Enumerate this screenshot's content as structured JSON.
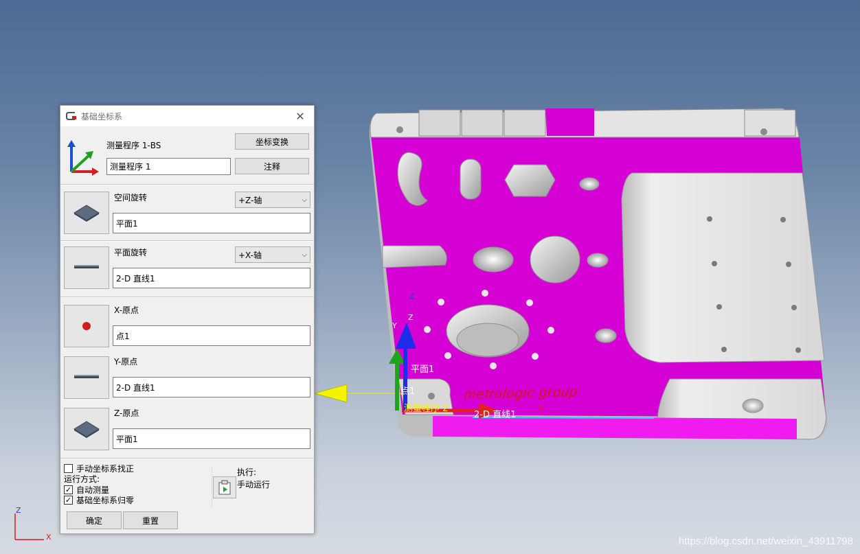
{
  "dialog": {
    "title": "基础坐标系",
    "program_label": "测量程序 1-BS",
    "program_name": "测量程序 1",
    "transform_button": "坐标变换",
    "comment_button": "注释",
    "spatial_rotation": {
      "label": "空间旋转",
      "axis": "+Z-轴",
      "feature": "平面1"
    },
    "plane_rotation": {
      "label": "平面旋转",
      "axis": "+X-轴",
      "feature": "2-D 直线1"
    },
    "x_origin": {
      "label": "X-原点",
      "feature": "点1"
    },
    "y_origin": {
      "label": "Y-原点",
      "feature": "2-D 直线1"
    },
    "z_origin": {
      "label": "Z-原点",
      "feature": "平面1"
    },
    "manual_align": {
      "label": "手动坐标系找正",
      "checked": false
    },
    "run_mode_label": "运行方式:",
    "auto_measure": {
      "label": "自动测量",
      "checked": true
    },
    "base_zero": {
      "label": "基础坐标系归零",
      "checked": true
    },
    "execute_label": "执行:",
    "execute_mode": "手动运行",
    "ok_button": "确定",
    "reset_button": "重置"
  },
  "viewport": {
    "labels": {
      "z_axis_1": "Z",
      "z_axis_2": "Z",
      "y_axis": "Y",
      "plane": "平面1",
      "point": "点1",
      "program": "测量程序 2",
      "line": "2-D 直线1",
      "x_axis": "X",
      "brand": "metrologic group",
      "corner_z": "Z",
      "corner_x": "X"
    },
    "part_color": "#d400d4",
    "watermark": "https://blog.csdn.net/weixin_43911798"
  }
}
